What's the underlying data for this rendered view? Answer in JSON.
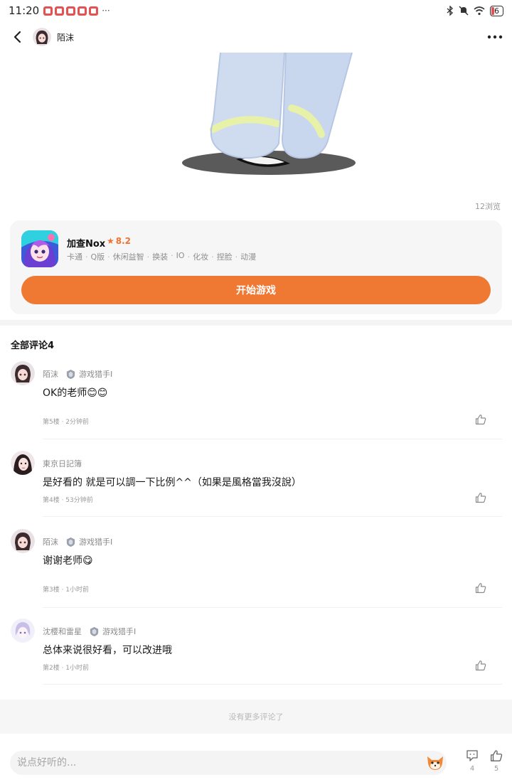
{
  "status_bar": {
    "time": "11:20",
    "more": "···",
    "battery": "6",
    "notification_icon_count": 5
  },
  "nav": {
    "author_name": "陌沫",
    "back_icon": "chevron-left-icon",
    "more_icon": "more-dots-icon"
  },
  "post": {
    "views": "12浏览"
  },
  "game": {
    "name": "加查Nox",
    "rating": "8.2",
    "tags": [
      "卡通",
      "Q版",
      "休闲益智",
      "换装",
      "IO",
      "化妆",
      "捏脸",
      "动漫"
    ],
    "start_label": "开始游戏",
    "accent_color": "#ef7833"
  },
  "comments_section": {
    "title": "全部评论4",
    "items": [
      {
        "author": "陌沫",
        "badge": "游戏猎手Ⅰ",
        "text": "OK的老师😊😊",
        "meta": "第5楼 · 2分钟前",
        "has_badge": true
      },
      {
        "author": "東京日記簿",
        "badge": "",
        "text": "是好看的 就是可以調一下比例^^（如果是風格當我沒說）",
        "meta": "第4楼 · 53分钟前",
        "has_badge": false
      },
      {
        "author": "陌沫",
        "badge": "游戏猎手Ⅰ",
        "text": "谢谢老师😋",
        "meta": "第3楼 · 1小时前",
        "has_badge": true
      },
      {
        "author": "沈樱和雷星",
        "badge": "游戏猎手Ⅰ",
        "text": "总体来说很好看，可以改进哦",
        "meta": "第2楼 · 1小时前",
        "has_badge": true
      }
    ],
    "no_more": "没有更多评论了"
  },
  "bottom_bar": {
    "input_placeholder": "说点好听的...",
    "comment_count": "4",
    "like_count": "5"
  }
}
